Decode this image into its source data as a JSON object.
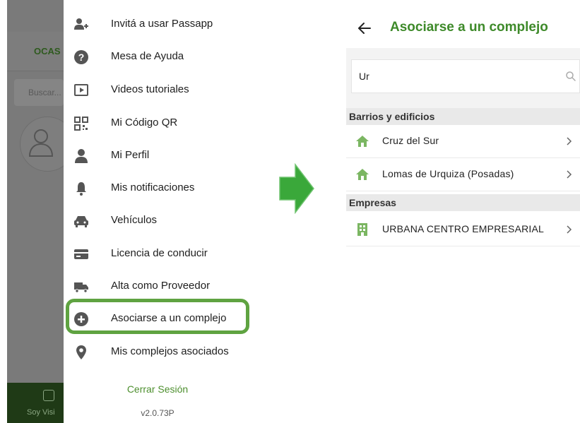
{
  "left_screen": {
    "background": {
      "tab_label": "OCAS",
      "search_placeholder": "Buscar...",
      "bottom_nav_label": "Soy Visi"
    },
    "menu": {
      "items": [
        {
          "label": "Invitá a usar Passapp",
          "icon": "add-person-icon"
        },
        {
          "label": "Mesa de Ayuda",
          "icon": "help-circle-icon"
        },
        {
          "label": "Videos tutoriales",
          "icon": "video-play-icon"
        },
        {
          "label": "Mi Código QR",
          "icon": "qr-code-icon"
        },
        {
          "label": "Mi Perfil",
          "icon": "person-icon"
        },
        {
          "label": "Mis notificaciones",
          "icon": "bell-icon"
        },
        {
          "label": "Vehículos",
          "icon": "car-icon"
        },
        {
          "label": "Licencia de conducir",
          "icon": "credit-card-icon"
        },
        {
          "label": "Alta como Proveedor",
          "icon": "truck-icon"
        },
        {
          "label": "Asociarse a un complejo",
          "icon": "plus-circle-icon",
          "highlighted": true
        },
        {
          "label": "Mis complejos asociados",
          "icon": "location-pin-icon"
        }
      ],
      "logout_label": "Cerrar Sesión",
      "version": "v2.0.73P"
    }
  },
  "right_screen": {
    "header": {
      "title": "Asociarse a un complejo",
      "back_icon": "arrow-left-icon"
    },
    "search": {
      "value": "Ur",
      "icon": "search-icon"
    },
    "sections": [
      {
        "title": "Barrios y edificios",
        "items": [
          {
            "label": "Cruz del Sur",
            "icon": "house-icon"
          },
          {
            "label": "Lomas de Urquiza (Posadas)",
            "icon": "house-icon"
          }
        ]
      },
      {
        "title": "Empresas",
        "items": [
          {
            "label": "URBANA CENTRO EMPRESARIAL",
            "icon": "building-icon"
          }
        ]
      }
    ]
  },
  "colors": {
    "brand_green": "#3e8a2a",
    "highlight_green": "#5fa341",
    "arrow_green": "#3aa83a",
    "overlay_gray": "#8a8a8a"
  }
}
